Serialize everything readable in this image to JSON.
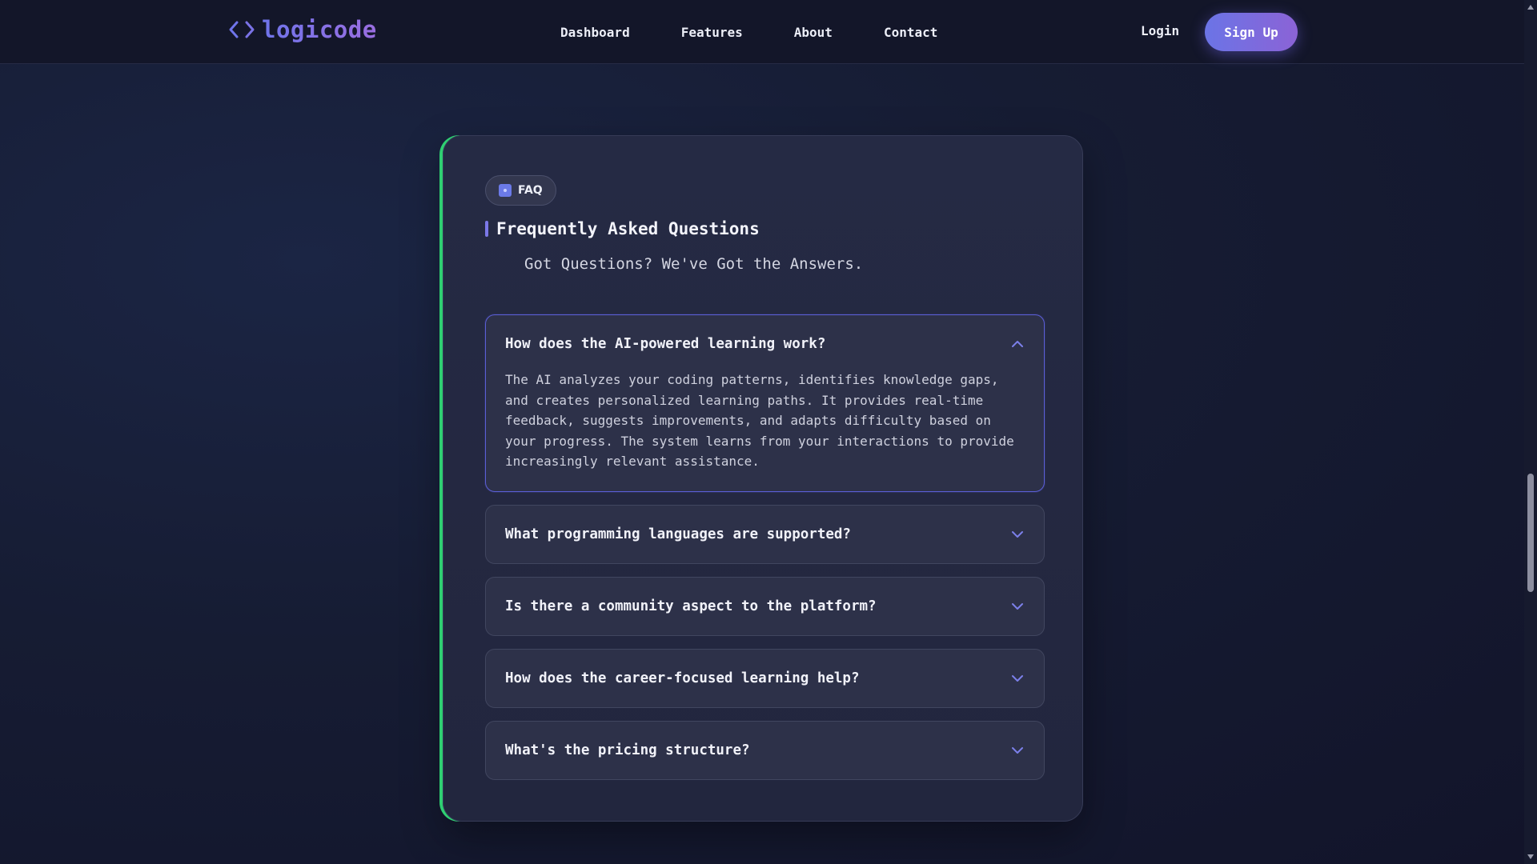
{
  "colors": {
    "accent": "#6f74ea",
    "accent_purple": "#8b63d6",
    "card_border_left": "#2fcf72",
    "background": "#161c33"
  },
  "navbar": {
    "logo_text": "logicode",
    "logo_icon": "code-brackets-icon",
    "links": [
      "Dashboard",
      "Features",
      "About",
      "Contact"
    ],
    "login_label": "Login",
    "signup_label": "Sign Up"
  },
  "faq": {
    "badge_label": "FAQ",
    "title": "Frequently Asked Questions",
    "subtitle": "Got Questions? We've Got the Answers.",
    "items": [
      {
        "question": "How does the AI-powered learning work?",
        "answer": "The AI analyzes your coding patterns, identifies knowledge gaps, and creates personalized learning paths. It provides real-time feedback, suggests improvements, and adapts difficulty based on your progress. The system learns from your interactions to provide increasingly relevant assistance.",
        "expanded": true,
        "icon": "chevron-up-icon"
      },
      {
        "question": "What programming languages are supported?",
        "expanded": false,
        "icon": "chevron-down-icon"
      },
      {
        "question": "Is there a community aspect to the platform?",
        "expanded": false,
        "icon": "chevron-down-icon"
      },
      {
        "question": "How does the career-focused learning help?",
        "expanded": false,
        "icon": "chevron-down-icon"
      },
      {
        "question": "What's the pricing structure?",
        "expanded": false,
        "icon": "chevron-down-icon"
      }
    ]
  }
}
